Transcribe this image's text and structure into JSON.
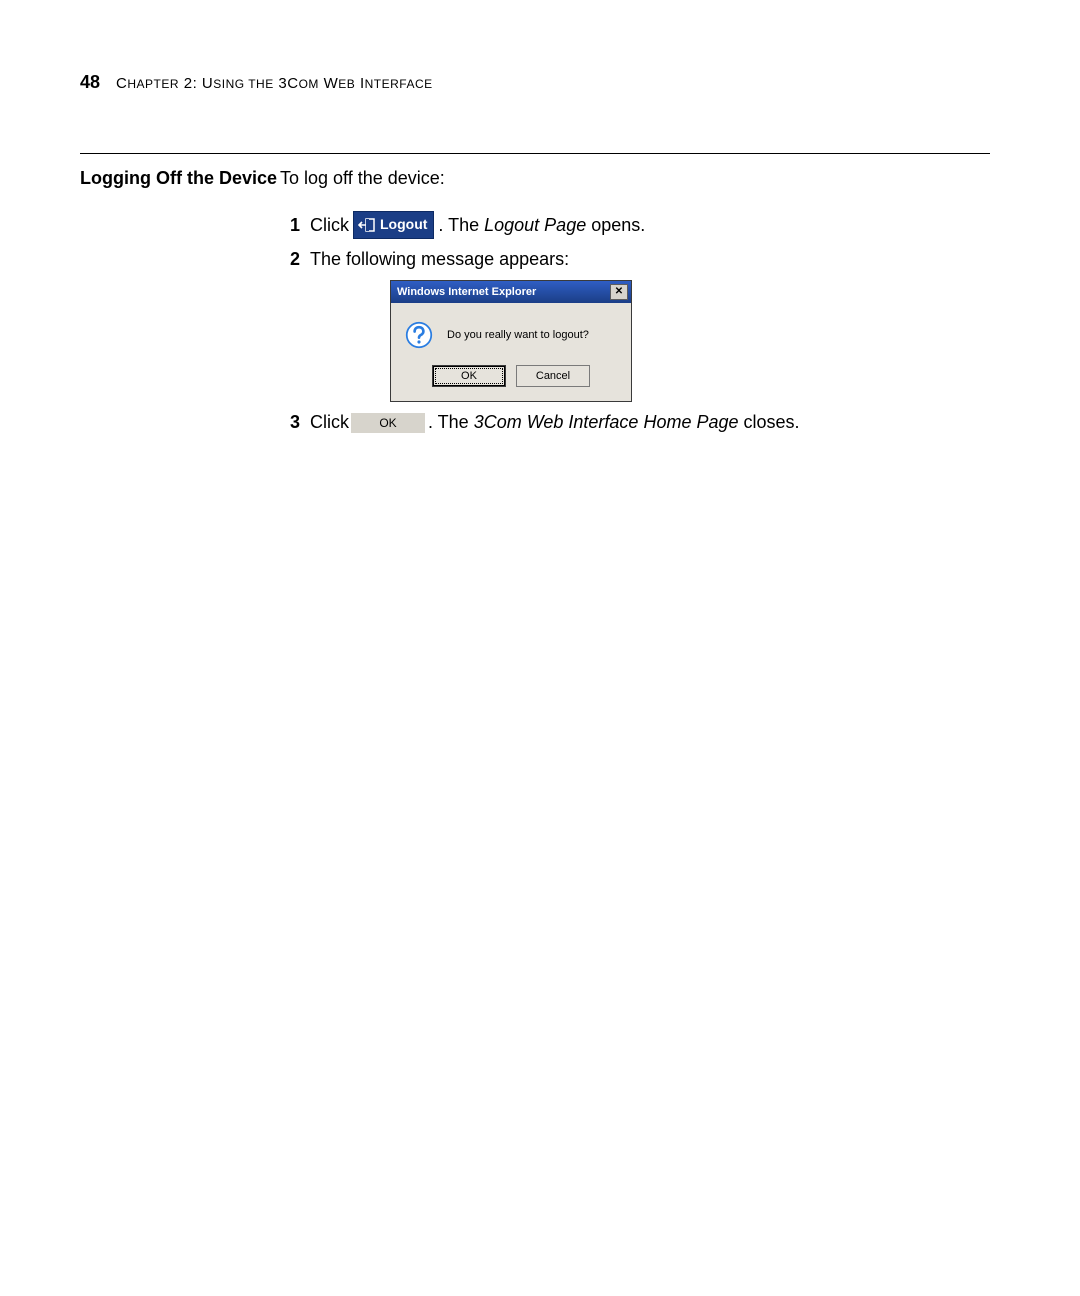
{
  "header": {
    "page_number": "48",
    "chapter_label_prefix": "C",
    "chapter_label_rest": "HAPTER",
    "chapter_number": "2:",
    "chapter_title_prefix": "U",
    "chapter_title_mid1": "SING THE",
    "chapter_title_prefix2": "3C",
    "chapter_title_mid2": "OM",
    "chapter_title_prefix3": "W",
    "chapter_title_mid3": "EB",
    "chapter_title_prefix4": "I",
    "chapter_title_mid4": "NTERFACE"
  },
  "section": {
    "title": "Logging Off the Device"
  },
  "intro": "To log off the device:",
  "steps": {
    "s1": {
      "num": "1",
      "pre": "Click",
      "logout_label": "Logout",
      "post_pre": ". The ",
      "post_italic": "Logout Page",
      "post_after": " opens."
    },
    "s2": {
      "num": "2",
      "text": "The following message appears:"
    },
    "s3": {
      "num": "3",
      "pre": "Click",
      "ok_label": "OK",
      "post_pre": ". The ",
      "post_italic": "3Com Web Interface Home Page",
      "post_after": " closes."
    }
  },
  "dialog": {
    "title": "Windows Internet Explorer",
    "close_glyph": "✕",
    "message": "Do you really want to logout?",
    "ok": "OK",
    "cancel": "Cancel"
  }
}
